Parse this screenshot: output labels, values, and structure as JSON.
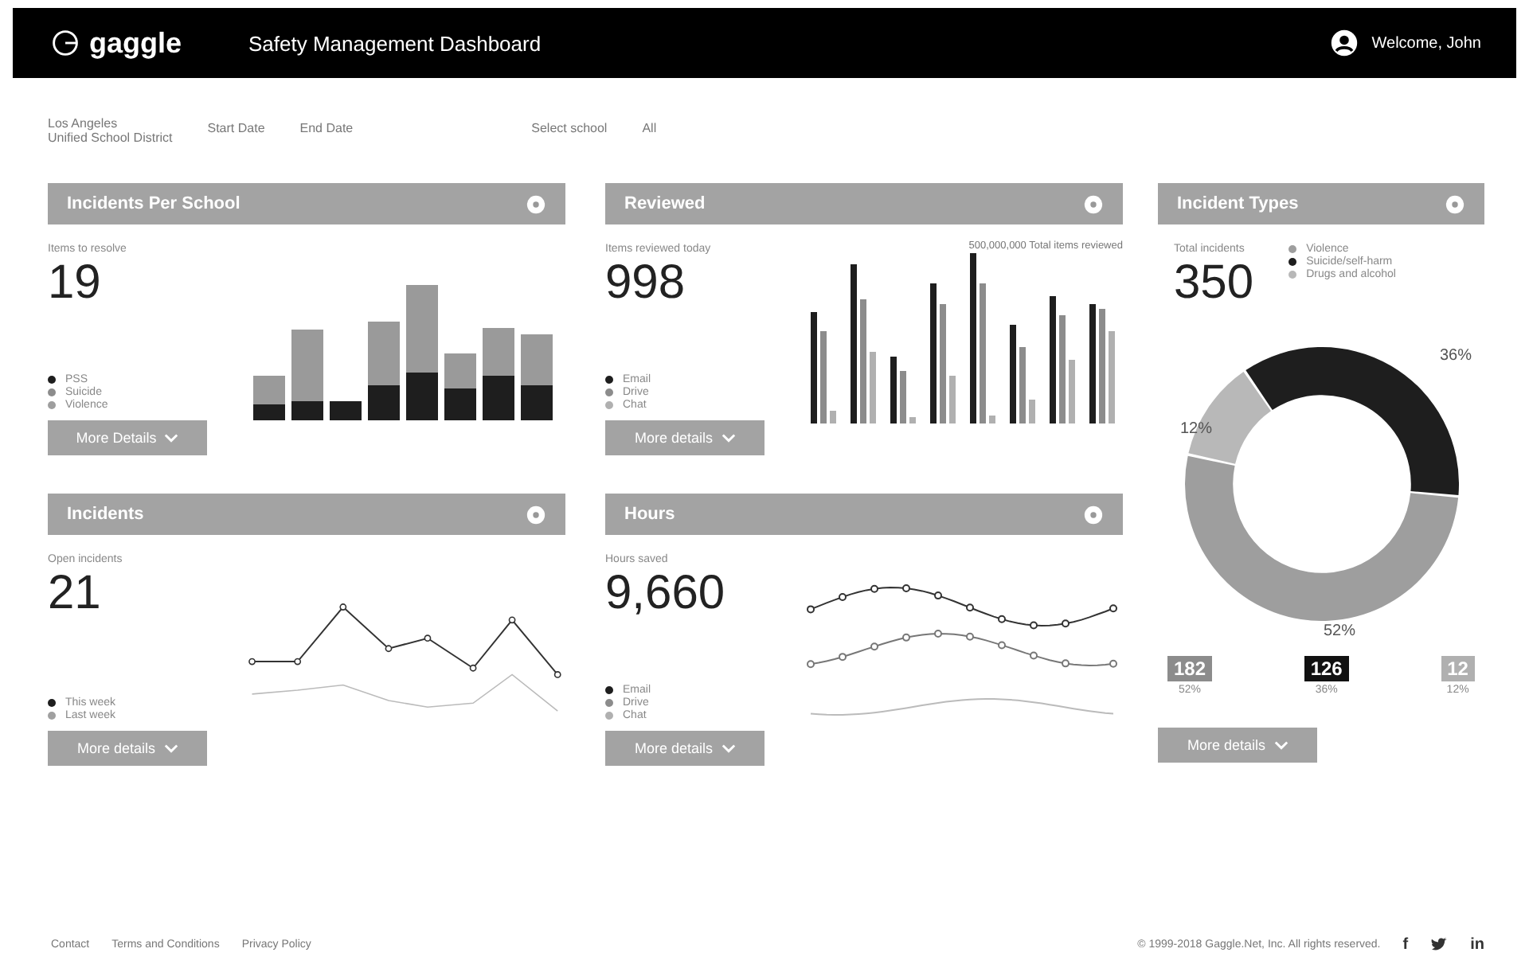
{
  "header": {
    "logo": "gaggle",
    "title": "Safety Management Dashboard",
    "user": "Welcome, John"
  },
  "filters": {
    "district": [
      "Los Angeles",
      "Unified School District"
    ],
    "start_date": "Start Date",
    "end_date": "End Date",
    "school_label": "Select school",
    "school_value": "All"
  },
  "cards": [
    {
      "title": "Incidents Per School",
      "kind": "stacked",
      "caption": "Items to resolve",
      "big": "19",
      "legend": [
        {
          "label": "PSS",
          "color": "#1e1e1e"
        },
        {
          "label": "Suicide",
          "color": "#8c8c8c"
        },
        {
          "label": "Violence",
          "color": "#9e9e9e"
        }
      ],
      "button": "More Details"
    },
    {
      "title": "Reviewed",
      "kind": "grouped",
      "caption": "Items reviewed today",
      "big": "998",
      "note": "500,000,000 Total items reviewed",
      "legend": [
        {
          "label": "Email",
          "color": "#1e1e1e"
        },
        {
          "label": "Drive",
          "color": "#8c8c8c"
        },
        {
          "label": "Chat",
          "color": "#b0b0b0"
        }
      ],
      "button": "More details"
    },
    {
      "title": "Incidents",
      "kind": "lines",
      "caption": "Open incidents",
      "big": "21",
      "legend": [
        {
          "label": "This week",
          "color": "#1e1e1e"
        },
        {
          "label": "Last week",
          "color": "#a0a0a0"
        }
      ],
      "button": "More details"
    },
    {
      "title": "Hours",
      "kind": "waves",
      "caption": "Hours saved",
      "big": "9,660",
      "legend": [
        {
          "label": "Email",
          "color": "#1e1e1e"
        },
        {
          "label": "Drive",
          "color": "#8c8c8c"
        },
        {
          "label": "Chat",
          "color": "#b0b0b0"
        }
      ],
      "button": "More details"
    }
  ],
  "types": {
    "title": "Incident Types",
    "caption": "Total incidents",
    "big": "350",
    "legend": [
      {
        "label": "Violence",
        "color": "#9e9e9e"
      },
      {
        "label": "Suicide/self-harm",
        "color": "#1e1e1e"
      },
      {
        "label": "Drugs and alcohol",
        "color": "#b8b8b8"
      }
    ],
    "slices": [
      {
        "label": "36%",
        "color": "#1e1e1e"
      },
      {
        "label": "52%",
        "color": "#9e9e9e"
      },
      {
        "label": "12%",
        "color": "#b8b8b8"
      }
    ],
    "stats": [
      {
        "value": "182",
        "label": "52%",
        "color": "#8c8c8c"
      },
      {
        "value": "126",
        "label": "36%",
        "color": "#111111"
      },
      {
        "value": "12",
        "label": "12%",
        "color": "#b0b0b0"
      }
    ],
    "button": "More details"
  },
  "footer": {
    "links": [
      "Contact",
      "Terms and Conditions",
      "Privacy Policy"
    ],
    "copyright": "© 1999-2018 Gaggle.Net, Inc. All rights reserved.",
    "social": [
      "f",
      "in"
    ]
  }
}
